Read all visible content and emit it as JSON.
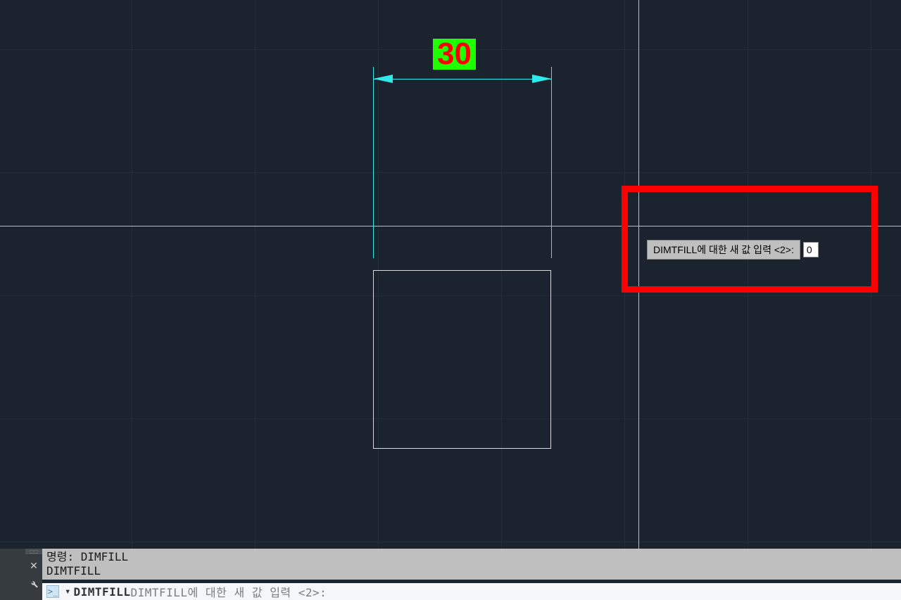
{
  "drawing": {
    "dimension_value": "30",
    "colors": {
      "dim_bg": "#1eff00",
      "dim_fg": "#ff0000",
      "cyan": "#2feaea",
      "rect": "#d8dce0",
      "highlight": "#ff0000"
    }
  },
  "dynamic_input": {
    "prompt": "DIMTFILL에 대한 새 값 입력 <2>:",
    "value": "0"
  },
  "command_history": {
    "line1": "명령: DIMFILL",
    "line2": "DIMTFILL"
  },
  "command_input": {
    "bold_prefix": "DIMTFILL",
    "gray_suffix": " DIMTFILL에 대한 새 값 입력 <2>:"
  }
}
